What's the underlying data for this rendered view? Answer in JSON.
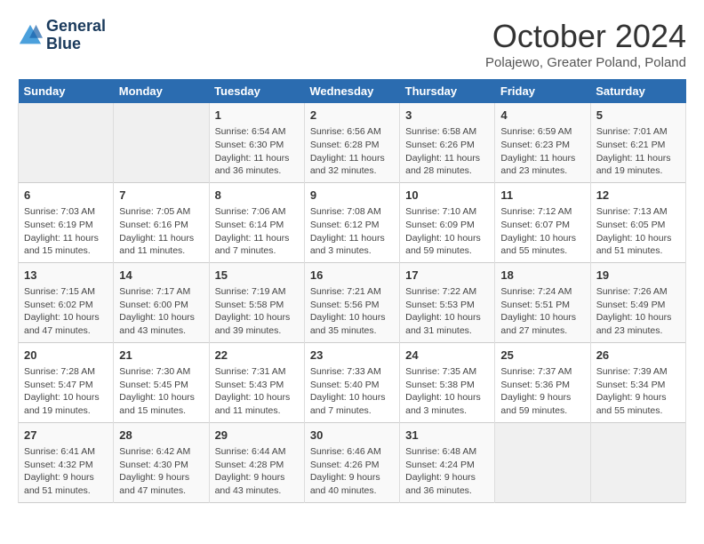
{
  "header": {
    "logo_line1": "General",
    "logo_line2": "Blue",
    "month": "October 2024",
    "location": "Polajewo, Greater Poland, Poland"
  },
  "weekdays": [
    "Sunday",
    "Monday",
    "Tuesday",
    "Wednesday",
    "Thursday",
    "Friday",
    "Saturday"
  ],
  "weeks": [
    [
      {
        "day": "",
        "sunrise": "",
        "sunset": "",
        "daylight": ""
      },
      {
        "day": "",
        "sunrise": "",
        "sunset": "",
        "daylight": ""
      },
      {
        "day": "1",
        "sunrise": "Sunrise: 6:54 AM",
        "sunset": "Sunset: 6:30 PM",
        "daylight": "Daylight: 11 hours and 36 minutes."
      },
      {
        "day": "2",
        "sunrise": "Sunrise: 6:56 AM",
        "sunset": "Sunset: 6:28 PM",
        "daylight": "Daylight: 11 hours and 32 minutes."
      },
      {
        "day": "3",
        "sunrise": "Sunrise: 6:58 AM",
        "sunset": "Sunset: 6:26 PM",
        "daylight": "Daylight: 11 hours and 28 minutes."
      },
      {
        "day": "4",
        "sunrise": "Sunrise: 6:59 AM",
        "sunset": "Sunset: 6:23 PM",
        "daylight": "Daylight: 11 hours and 23 minutes."
      },
      {
        "day": "5",
        "sunrise": "Sunrise: 7:01 AM",
        "sunset": "Sunset: 6:21 PM",
        "daylight": "Daylight: 11 hours and 19 minutes."
      }
    ],
    [
      {
        "day": "6",
        "sunrise": "Sunrise: 7:03 AM",
        "sunset": "Sunset: 6:19 PM",
        "daylight": "Daylight: 11 hours and 15 minutes."
      },
      {
        "day": "7",
        "sunrise": "Sunrise: 7:05 AM",
        "sunset": "Sunset: 6:16 PM",
        "daylight": "Daylight: 11 hours and 11 minutes."
      },
      {
        "day": "8",
        "sunrise": "Sunrise: 7:06 AM",
        "sunset": "Sunset: 6:14 PM",
        "daylight": "Daylight: 11 hours and 7 minutes."
      },
      {
        "day": "9",
        "sunrise": "Sunrise: 7:08 AM",
        "sunset": "Sunset: 6:12 PM",
        "daylight": "Daylight: 11 hours and 3 minutes."
      },
      {
        "day": "10",
        "sunrise": "Sunrise: 7:10 AM",
        "sunset": "Sunset: 6:09 PM",
        "daylight": "Daylight: 10 hours and 59 minutes."
      },
      {
        "day": "11",
        "sunrise": "Sunrise: 7:12 AM",
        "sunset": "Sunset: 6:07 PM",
        "daylight": "Daylight: 10 hours and 55 minutes."
      },
      {
        "day": "12",
        "sunrise": "Sunrise: 7:13 AM",
        "sunset": "Sunset: 6:05 PM",
        "daylight": "Daylight: 10 hours and 51 minutes."
      }
    ],
    [
      {
        "day": "13",
        "sunrise": "Sunrise: 7:15 AM",
        "sunset": "Sunset: 6:02 PM",
        "daylight": "Daylight: 10 hours and 47 minutes."
      },
      {
        "day": "14",
        "sunrise": "Sunrise: 7:17 AM",
        "sunset": "Sunset: 6:00 PM",
        "daylight": "Daylight: 10 hours and 43 minutes."
      },
      {
        "day": "15",
        "sunrise": "Sunrise: 7:19 AM",
        "sunset": "Sunset: 5:58 PM",
        "daylight": "Daylight: 10 hours and 39 minutes."
      },
      {
        "day": "16",
        "sunrise": "Sunrise: 7:21 AM",
        "sunset": "Sunset: 5:56 PM",
        "daylight": "Daylight: 10 hours and 35 minutes."
      },
      {
        "day": "17",
        "sunrise": "Sunrise: 7:22 AM",
        "sunset": "Sunset: 5:53 PM",
        "daylight": "Daylight: 10 hours and 31 minutes."
      },
      {
        "day": "18",
        "sunrise": "Sunrise: 7:24 AM",
        "sunset": "Sunset: 5:51 PM",
        "daylight": "Daylight: 10 hours and 27 minutes."
      },
      {
        "day": "19",
        "sunrise": "Sunrise: 7:26 AM",
        "sunset": "Sunset: 5:49 PM",
        "daylight": "Daylight: 10 hours and 23 minutes."
      }
    ],
    [
      {
        "day": "20",
        "sunrise": "Sunrise: 7:28 AM",
        "sunset": "Sunset: 5:47 PM",
        "daylight": "Daylight: 10 hours and 19 minutes."
      },
      {
        "day": "21",
        "sunrise": "Sunrise: 7:30 AM",
        "sunset": "Sunset: 5:45 PM",
        "daylight": "Daylight: 10 hours and 15 minutes."
      },
      {
        "day": "22",
        "sunrise": "Sunrise: 7:31 AM",
        "sunset": "Sunset: 5:43 PM",
        "daylight": "Daylight: 10 hours and 11 minutes."
      },
      {
        "day": "23",
        "sunrise": "Sunrise: 7:33 AM",
        "sunset": "Sunset: 5:40 PM",
        "daylight": "Daylight: 10 hours and 7 minutes."
      },
      {
        "day": "24",
        "sunrise": "Sunrise: 7:35 AM",
        "sunset": "Sunset: 5:38 PM",
        "daylight": "Daylight: 10 hours and 3 minutes."
      },
      {
        "day": "25",
        "sunrise": "Sunrise: 7:37 AM",
        "sunset": "Sunset: 5:36 PM",
        "daylight": "Daylight: 9 hours and 59 minutes."
      },
      {
        "day": "26",
        "sunrise": "Sunrise: 7:39 AM",
        "sunset": "Sunset: 5:34 PM",
        "daylight": "Daylight: 9 hours and 55 minutes."
      }
    ],
    [
      {
        "day": "27",
        "sunrise": "Sunrise: 6:41 AM",
        "sunset": "Sunset: 4:32 PM",
        "daylight": "Daylight: 9 hours and 51 minutes."
      },
      {
        "day": "28",
        "sunrise": "Sunrise: 6:42 AM",
        "sunset": "Sunset: 4:30 PM",
        "daylight": "Daylight: 9 hours and 47 minutes."
      },
      {
        "day": "29",
        "sunrise": "Sunrise: 6:44 AM",
        "sunset": "Sunset: 4:28 PM",
        "daylight": "Daylight: 9 hours and 43 minutes."
      },
      {
        "day": "30",
        "sunrise": "Sunrise: 6:46 AM",
        "sunset": "Sunset: 4:26 PM",
        "daylight": "Daylight: 9 hours and 40 minutes."
      },
      {
        "day": "31",
        "sunrise": "Sunrise: 6:48 AM",
        "sunset": "Sunset: 4:24 PM",
        "daylight": "Daylight: 9 hours and 36 minutes."
      },
      {
        "day": "",
        "sunrise": "",
        "sunset": "",
        "daylight": ""
      },
      {
        "day": "",
        "sunrise": "",
        "sunset": "",
        "daylight": ""
      }
    ]
  ]
}
